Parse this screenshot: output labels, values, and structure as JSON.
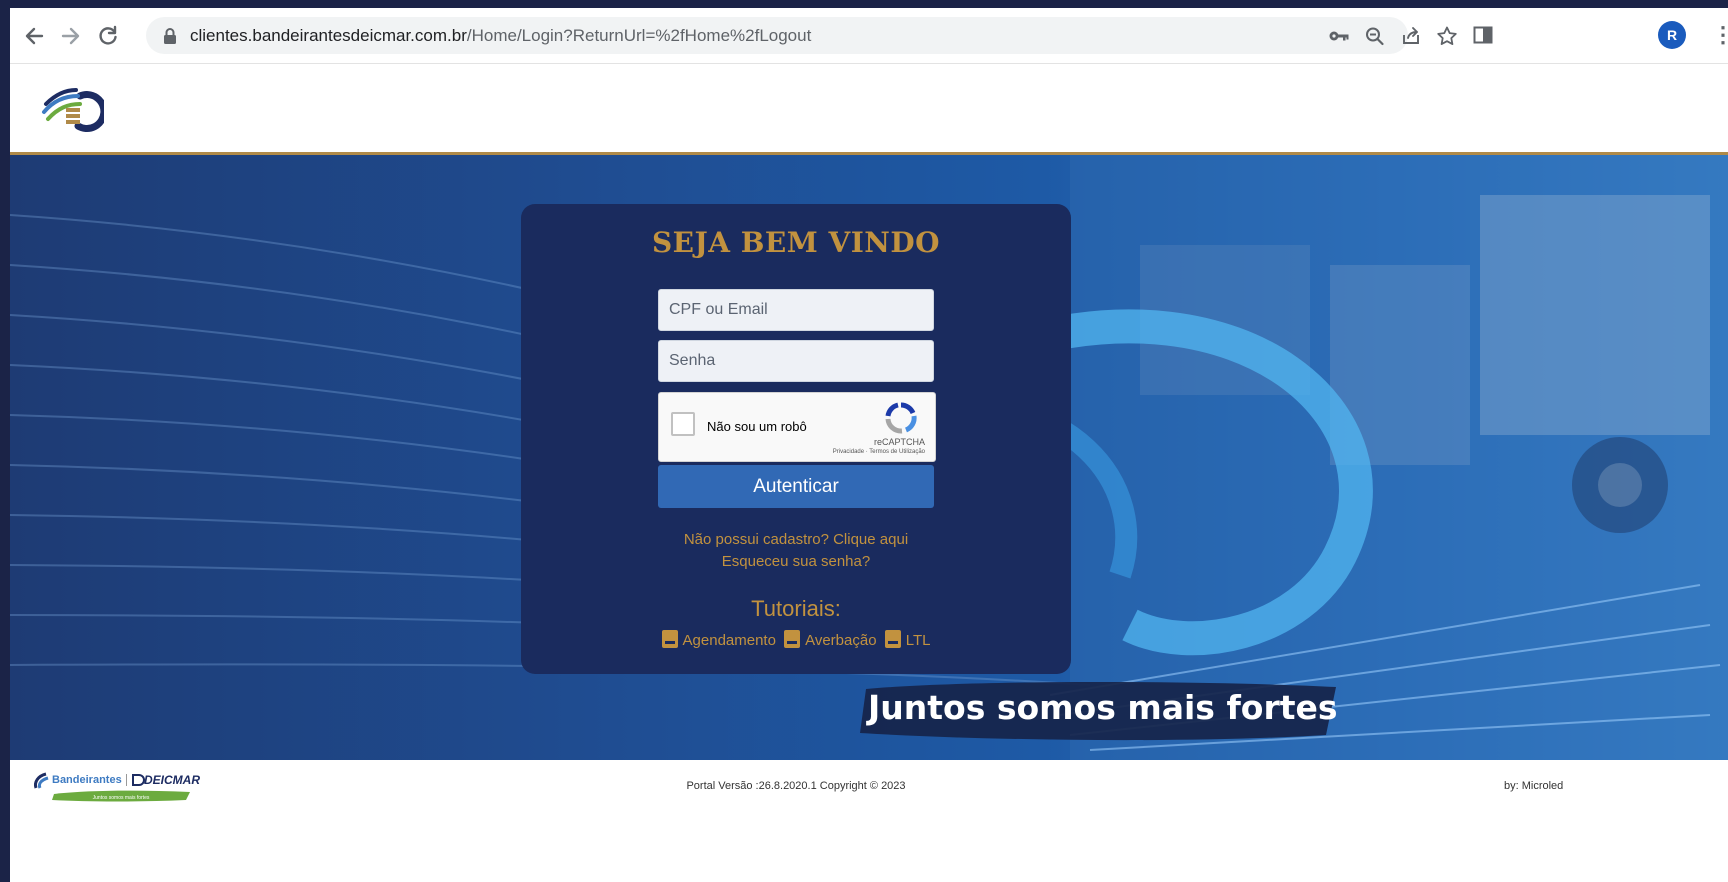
{
  "browser": {
    "url_host": "clientes.bandeirantesdeicmar.com.br",
    "url_path": "/Home/Login?ReturnUrl=%2fHome%2fLogout",
    "profile_initial": "R",
    "icons": [
      "back-arrow-icon",
      "forward-arrow-icon",
      "reload-icon",
      "lock-icon",
      "key-icon",
      "zoom-out-icon",
      "share-icon",
      "star-icon",
      "side-panel-icon",
      "kebab-menu-icon"
    ]
  },
  "login": {
    "title": "SEJA BEM VINDO",
    "login_placeholder": "CPF ou Email",
    "password_placeholder": "Senha",
    "recaptcha_label": "Não sou um robô",
    "recaptcha_brand": "reCAPTCHA",
    "recaptcha_terms": "Privacidade · Termos de Utilização",
    "submit_label": "Autenticar",
    "register_link": "Não possui cadastro? Clique aqui",
    "forgot_link": "Esqueceu sua senha?",
    "tutorials_heading": "Tutoriais:",
    "tutorials": [
      "Agendamento",
      "Averbação",
      "LTL"
    ]
  },
  "hero": {
    "slogan": "Juntos somos mais fortes"
  },
  "footer": {
    "logo_brand_left": "Bandeirantes",
    "logo_brand_right": "DEICMAR",
    "logo_tagline": "Juntos somos mais fortes",
    "version_text": "Portal Versão :26.8.2020.1   Copyright © 2023",
    "by_text": "by: Microled"
  },
  "colors": {
    "gold": "#c2923f",
    "card": "#1a2b5e",
    "button": "#3169b5",
    "hero_dark": "#1e3b74",
    "hero_light": "#3b86cf"
  }
}
